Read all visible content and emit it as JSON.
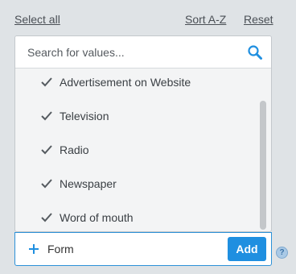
{
  "toolbar": {
    "select_all": "Select all",
    "sort": "Sort A-Z",
    "reset": "Reset"
  },
  "search": {
    "placeholder": "Search for values...",
    "icon": "search-icon"
  },
  "items": [
    {
      "label": "Advertisement on Website",
      "checked": true
    },
    {
      "label": "Television",
      "checked": true
    },
    {
      "label": "Radio",
      "checked": true
    },
    {
      "label": "Newspaper",
      "checked": true
    },
    {
      "label": "Word of mouth",
      "checked": true
    }
  ],
  "add": {
    "value": "Form",
    "button_label": "Add"
  },
  "help": {
    "label": "?"
  },
  "colors": {
    "accent": "#1f8fe0",
    "background": "#dfe3e6"
  }
}
